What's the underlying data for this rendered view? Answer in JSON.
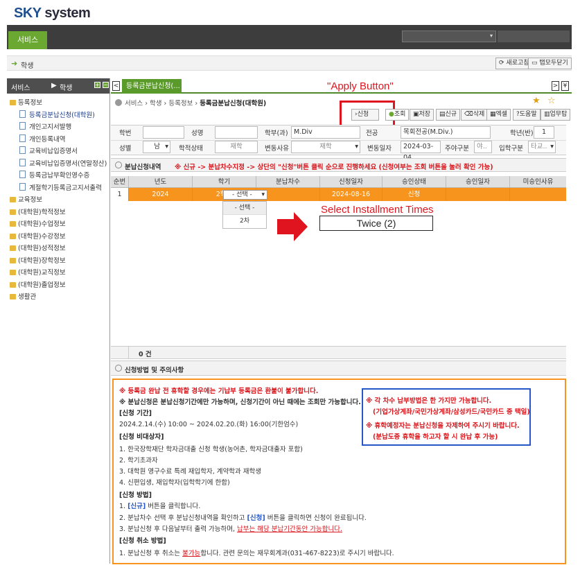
{
  "app": {
    "logo_sky": "SKY",
    "logo_rest": " system",
    "service_menu": "서비스"
  },
  "subnav": {
    "label": "학생",
    "refresh": "새로고침",
    "close_all": "탭모두닫기"
  },
  "sidebar": {
    "header_a": "서비스",
    "header_b": "학생",
    "items": [
      {
        "label": "등록정보",
        "type": "folder",
        "level": 0
      },
      {
        "label": "등록금분납신청(대학원)",
        "type": "doc",
        "level": 1,
        "selected": true
      },
      {
        "label": "개인고지서발행",
        "type": "doc",
        "level": 1
      },
      {
        "label": "개인등록내역",
        "type": "doc",
        "level": 1
      },
      {
        "label": "교육비납입증명서",
        "type": "doc",
        "level": 1
      },
      {
        "label": "교육비납입증명서(연말정산)",
        "type": "doc",
        "level": 1
      },
      {
        "label": "등록금납부확인영수증",
        "type": "doc",
        "level": 1
      },
      {
        "label": "계절학기등록금고지서출력",
        "type": "doc",
        "level": 1
      },
      {
        "label": "교육정보",
        "type": "folder",
        "level": 0
      },
      {
        "label": "(대학원)학적정보",
        "type": "folder",
        "level": 0
      },
      {
        "label": "(대학원)수업정보",
        "type": "folder",
        "level": 0
      },
      {
        "label": "(대학원)수강정보",
        "type": "folder",
        "level": 0
      },
      {
        "label": "(대학원)성적정보",
        "type": "folder",
        "level": 0
      },
      {
        "label": "(대학원)장학정보",
        "type": "folder",
        "level": 0
      },
      {
        "label": "(대학원)교직정보",
        "type": "folder",
        "level": 0
      },
      {
        "label": "(대학원)졸업정보",
        "type": "folder",
        "level": 0
      },
      {
        "label": "생활관",
        "type": "folder",
        "level": 0
      }
    ]
  },
  "tab": {
    "label": "등록금분납신청(..."
  },
  "annotations": {
    "apply": "\"Apply  Button\"",
    "select": "Select  Installment  Times",
    "twice": "Twice  (2)"
  },
  "breadcrumb": {
    "path": "서비스 › 학생 › 등록정보 › ",
    "current": "등록금분납신청(대학원)"
  },
  "toolbar": {
    "apply": "신청",
    "search": "조회",
    "save": "저장",
    "new": "신규",
    "delete": "삭제",
    "excel": "엑셀",
    "help": "도움말",
    "manual": "업무탑"
  },
  "form": {
    "student_no_label": "학번",
    "student_no": "",
    "name_label": "성명",
    "name": "",
    "dept_label": "학부(과)",
    "dept": "M.Div",
    "apply_label": "전공",
    "major": "목회전공(M.Div.)",
    "grade_label": "학년(반)",
    "grade": "1",
    "gender_label": "성별",
    "gender": "남",
    "status_label": "학적상태",
    "status": "재학",
    "change_label": "변동사유",
    "change": "재학",
    "change_date_label": "변동일자",
    "change_date": "2024-03-04",
    "daynight_label": "주야구분",
    "daynight": "야..",
    "entry_label": "입학구분",
    "entry": "타교.."
  },
  "section1": {
    "title": "분납신청내역",
    "hint": "※ 신규 -> 분납차수지정 -> 상단의 \"신청\"버튼 클릭 순으로 진행하세요 (신청여부는 조회 버튼을 눌러 확인 가능)"
  },
  "table": {
    "headers": [
      "순번",
      "년도",
      "학기",
      "분납차수",
      "신청일자",
      "승인상태",
      "승인일자",
      "미승인사유"
    ],
    "row": {
      "no": "1",
      "year": "2024",
      "term": "2학기",
      "times": "- 선택 -",
      "date": "2024-08-16",
      "status": "신청",
      "approve_date": "",
      "reason": ""
    },
    "dropdown": [
      "- 선택 -",
      "2차"
    ],
    "count": "0 건"
  },
  "section2": {
    "title": "신청방법 및 주의사항"
  },
  "notice": {
    "l1": "※ 등록금 완납 전 휴학할 경우에는 기납부 등록금은 환불이 불가합니다.",
    "l2": "※ 분납신청은 분납신청기간에만 가능하며, 신청기간이 아닌 때에는 조회만 가능합니다.",
    "h1": "[신청 기간]",
    "p1": "2024.2.14.(수) 10:00 ~ 2024.02.20.(화) 16:00(기한엄수)",
    "h2": "[신청 비대상자]",
    "p2a": "1. 한국장학재단 학자금대출 신청 학생(농어촌, 학자금대출자 포함)",
    "p2b": "2. 학기초과자",
    "p2c": "3. 대학원 영구수료 특례 재입학자, 계약학과 재학생",
    "p2d": "4. 신편입생, 재입학자(입학학기에 한함)",
    "h3": "[신청 방법]",
    "p3a1": "1. ",
    "p3a2": "[신규]",
    "p3a3": "   버튼을 클릭합니다.",
    "p3b1": "2. 분납차수 선택 후 분납신청내역을 확인하고 ",
    "p3b2": "[신청]",
    "p3b3": "   버튼을 클릭하면 신청이 완료됩니다.",
    "p3c1": "3. 분납신청 후 다음날부터 출력 가능하며, ",
    "p3c2": "납부는 해당 분납기간동안 가능합니다.",
    "h4": "[신청 취소 방법]",
    "p4a": "1. 분납신청 후 취소는 ",
    "p4b": "불가능",
    "p4c": "합니다. 관련 문의는 재무회계과(031-467-8223)로 주시기 바랍니다.",
    "b1": "※ 각 차수 납부방법은 한 가지만 가능합니다.",
    "b2": "(기업가상계좌/국민가상계좌/삼성카드/국민카드 중 택일)",
    "b3": "※ 휴학예정자는 분납신청을 자제하여 주시기 바랍니다.",
    "b4": "(분납도중 휴학을 하고자 할 시 완납 후 가능)"
  },
  "colors": {
    "green": "#6aa832",
    "orange": "#f7941d",
    "red": "#e0141e",
    "blue": "#2456c8"
  }
}
